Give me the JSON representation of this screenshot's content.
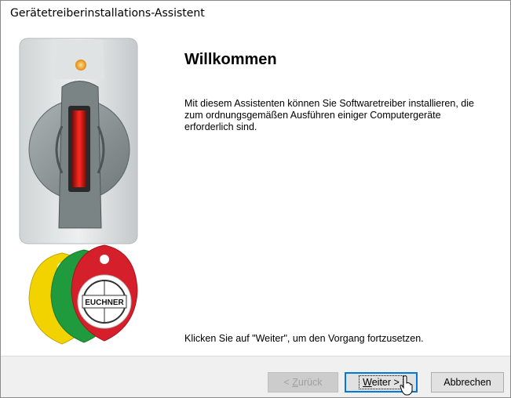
{
  "window": {
    "title": "Gerätetreiberinstallations-Assistent"
  },
  "main": {
    "heading": "Willkommen",
    "intro": "Mit diesem Assistenten können Sie Softwaretreiber installieren, die zum ordnungsgemäßen Ausführen einiger Computergeräte erforderlich sind.",
    "continue_hint": "Klicken Sie auf \"Weiter\", um den Vorgang fortzusetzen."
  },
  "branding": {
    "logo_text": "EUCHNER"
  },
  "buttons": {
    "back": {
      "prefix": "< ",
      "mnemonic": "Z",
      "rest": "urück",
      "enabled": false
    },
    "next": {
      "mnemonic": "W",
      "rest": "eiter >",
      "focused": true
    },
    "cancel": {
      "label": "Abbrechen"
    }
  },
  "colors": {
    "accent": "#0078d7",
    "footer_bg": "#f0f0f0",
    "tag_yellow": "#f2d300",
    "tag_green": "#1f9a3c",
    "tag_red": "#d51f2b",
    "reader_body": "#8c9596",
    "reader_led": "#f5a623",
    "reader_slot": "#d0191c"
  }
}
